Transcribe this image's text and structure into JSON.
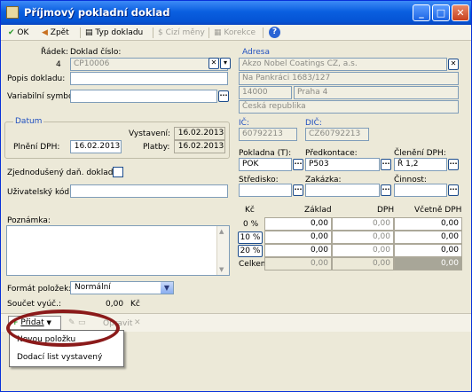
{
  "window": {
    "title": "Příjmový pokladní doklad",
    "min": "_",
    "max": "□",
    "close": "✕"
  },
  "toolbar": {
    "ok": "OK",
    "zpet": "Zpět",
    "typ": "Typ dokladu",
    "cizimeny": "Cizí měny",
    "korekce": "Korekce",
    "help": "?"
  },
  "doc": {
    "radek_label": "Řádek:",
    "radek": "4",
    "cislo_label": "Doklad číslo:",
    "cislo": "CP10006",
    "popis_label": "Popis dokladu:",
    "popis": "",
    "vs_label": "Variabilní symbol:",
    "vs": ""
  },
  "adresa": {
    "label": "Adresa",
    "line1": "Akzo Nobel Coatings CZ, a.s.",
    "line2": "Na Pankráci 1683/127",
    "psc": "14000",
    "mesto": "Praha 4",
    "stat": "Česká republika"
  },
  "datum": {
    "label": "Datum",
    "vystaveni_label": "Vystavení:",
    "vystaveni": "16.02.2013",
    "plneni_label": "Plnění DPH:",
    "plneni": "16.02.2013",
    "platby_label": "Platby:",
    "platby": "16.02.2013"
  },
  "ids": {
    "ic_label": "IČ:",
    "ic": "60792213",
    "dic_label": "DIČ:",
    "dic": "CZ60792213"
  },
  "fields": {
    "pokladna_label": "Pokladna (T):",
    "pokladna": "POK",
    "predkontace_label": "Předkontace:",
    "predkontace": "P503",
    "cleneni_label": "Členění DPH:",
    "cleneni": "Ř 1,2",
    "stredisko_label": "Středisko:",
    "stredisko": "",
    "zakazka_label": "Zakázka:",
    "zakazka": "",
    "cinnost_label": "Činnost:",
    "cinnost": ""
  },
  "zjednoduseny_label": "Zjednodušený daň. doklad:",
  "uzivatelsky_label": "Uživatelský kód:",
  "poznamka_label": "Poznámka:",
  "dph": {
    "headers": [
      "Kč",
      "Základ",
      "DPH",
      "Včetně DPH"
    ],
    "rows": [
      {
        "label": "0 %",
        "zaklad": "0,00",
        "dph": "0,00",
        "vcetne": "0,00"
      },
      {
        "label": "10 %",
        "zaklad": "0,00",
        "dph": "0,00",
        "vcetne": "0,00"
      },
      {
        "label": "20 %",
        "zaklad": "0,00",
        "dph": "0,00",
        "vcetne": "0,00"
      },
      {
        "label": "Celkem",
        "zaklad": "0,00",
        "dph": "0,00",
        "vcetne": "0,00"
      }
    ]
  },
  "format": {
    "label": "Formát položek:",
    "value": "Normální"
  },
  "soucet": {
    "label": "Součet vyúč.:",
    "value": "0,00",
    "unit": "Kč"
  },
  "bottom": {
    "pridat": "Přidat",
    "kontrola": "Kontrola",
    "opravit": "Opravit"
  },
  "menu": {
    "items": [
      "Novou položku",
      "Dodací list vystavený"
    ]
  },
  "colors": {
    "title_blue": "#0a5fe0",
    "highlight": "#8b1a1a",
    "label_blue": "#2050c0"
  }
}
